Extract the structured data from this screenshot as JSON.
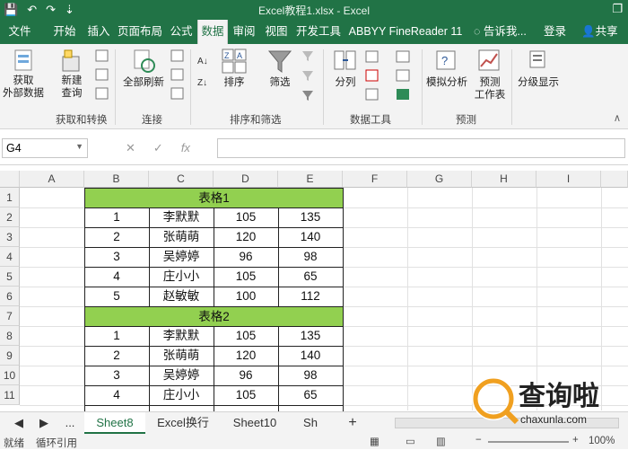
{
  "titlebar": {
    "title": "Excel教程1.xlsx - Excel",
    "save": "💾",
    "undo": "↶",
    "redo": "↷",
    "more": "⇣",
    "restore": "❐"
  },
  "tabs": [
    "文件",
    "开始",
    "插入",
    "页面布局",
    "公式",
    "数据",
    "审阅",
    "视图",
    "开发工具",
    "ABBYY FineReader 11"
  ],
  "tell_me": "告诉我...",
  "login": "登录",
  "share": "共享",
  "ribbon": {
    "get_external": "获取\n外部数据",
    "new_query": "新建\n查询",
    "refresh_all": "全部刷新",
    "sort": "排序",
    "filter": "筛选",
    "split": "分列",
    "whatif": "模拟分析",
    "forecast": "预测\n工作表",
    "outline": "分级显示",
    "groups": {
      "get_transform": "获取和转换",
      "connections": "连接",
      "sort_filter": "排序和筛选",
      "data_tools": "数据工具",
      "forecast": "预测"
    }
  },
  "namebox": "G4",
  "fx": "fx",
  "columns": [
    "A",
    "B",
    "C",
    "D",
    "E",
    "F",
    "G",
    "H",
    "I"
  ],
  "rows": [
    "1",
    "2",
    "3",
    "4",
    "5",
    "6",
    "7",
    "8",
    "9",
    "10",
    "11"
  ],
  "table1": {
    "header": "表格1",
    "rows": [
      [
        "1",
        "李默默",
        "105",
        "135"
      ],
      [
        "2",
        "张萌萌",
        "120",
        "140"
      ],
      [
        "3",
        "吴婷婷",
        "96",
        "98"
      ],
      [
        "4",
        "庄小小",
        "105",
        "65"
      ],
      [
        "5",
        "赵敏敏",
        "100",
        "112"
      ]
    ]
  },
  "table2": {
    "header": "表格2",
    "rows": [
      [
        "1",
        "李默默",
        "105",
        "135"
      ],
      [
        "2",
        "张萌萌",
        "120",
        "140"
      ],
      [
        "3",
        "吴婷婷",
        "96",
        "98"
      ],
      [
        "4",
        "庄小小",
        "105",
        "65"
      ]
    ]
  },
  "sheets": [
    "Sheet8",
    "Excel换行",
    "Sheet10",
    "Sh"
  ],
  "sheet_nav": {
    "prev": "◀",
    "next": "▶",
    "more": "...",
    "add": "+"
  },
  "status": {
    "ready": "就绪",
    "circular": "循环引用",
    "zoom": "100%",
    "zoom_minus": "−",
    "zoom_plus": "+"
  },
  "watermark": {
    "text": "查询啦",
    "url": "chaxunla.com"
  },
  "colors": {
    "excel_green": "#217346",
    "header_fill": "#92d050"
  }
}
